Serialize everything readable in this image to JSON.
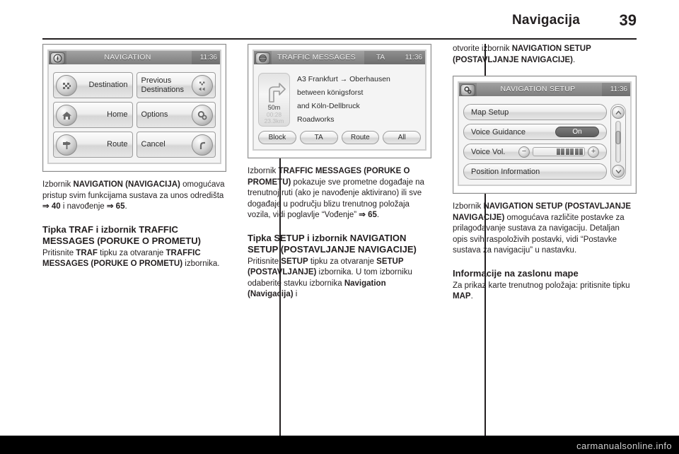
{
  "header": {
    "title": "Navigacija",
    "page_number": "39"
  },
  "screens": {
    "navigation": {
      "title": "NAVIGATION",
      "clock": "11:36",
      "icon": "compass-icon",
      "buttons": [
        {
          "label": "Destination",
          "icon": "checkered-flag-icon"
        },
        {
          "label": "Home",
          "icon": "home-icon"
        },
        {
          "label": "Route",
          "icon": "route-signpost-icon"
        },
        {
          "label": "Previous Destinations",
          "icon": "previous-destinations-icon"
        },
        {
          "label": "Options",
          "icon": "gears-icon"
        },
        {
          "label": "Cancel",
          "icon": "cancel-route-icon"
        }
      ]
    },
    "traffic_messages": {
      "title": "TRAFFIC MESSAGES",
      "ta_label": "TA",
      "clock": "11:36",
      "icon": "traffic-globe-icon",
      "turn": {
        "icon": "turn-right-icon",
        "distance": "50m",
        "eta": "00:28",
        "remaining": "23.3km"
      },
      "message_lines": [
        "A3 Frankfurt → Oberhausen",
        "between königsforst",
        "and Köln-Dellbruck",
        "Roadworks"
      ],
      "buttons": [
        "Block",
        "TA",
        "Route",
        "All"
      ]
    },
    "navigation_setup": {
      "title": "NAVIGATION SETUP",
      "clock": "11:36",
      "icon": "gears-icon",
      "rows": [
        {
          "label": "Map Setup",
          "control": "none"
        },
        {
          "label": "Voice Guidance",
          "control": "toggle",
          "value": "On"
        },
        {
          "label": "Voice Vol.",
          "control": "volume",
          "minus": "−",
          "plus": "+"
        },
        {
          "label": "Position Information",
          "control": "none"
        }
      ],
      "scrollbar": {
        "up": "up-chevron-icon",
        "down": "down-chevron-icon"
      }
    }
  },
  "column1": {
    "para1_pre": "Izbornik ",
    "para1_b1": "NAVIGATION (NAVIGACIJA)",
    "para1_mid": " omogućava pristup svim funkcijama sustava za unos odredišta ",
    "para1_ref1": "⇒ 40",
    "para1_mid2": " i navođenje ",
    "para1_ref2": "⇒ 65",
    "para1_end": ".",
    "heading": "Tipka TRAF i izbornik TRAFFIC MESSAGES (PORUKE O PROMETU)",
    "para2_pre": "Pritisnite ",
    "para2_b1": "TRAF",
    "para2_mid": " tipku za otvaranje ",
    "para2_b2": "TRAFFIC MESSAGES (PORUKE O PROMETU)",
    "para2_end": " izbornika."
  },
  "column2": {
    "para1_pre": "Izbornik ",
    "para1_b1": "TRAFFIC MESSAGES (PORUKE O PROMETU)",
    "para1_mid": " pokazuje sve prometne događaje na trenutnoj ruti (ako je navođenje aktivirano) ili sve događaje u području blizu trenutnog položaja vozila, vidi poglavlje “Vođenje” ",
    "para1_ref": "⇒ 65",
    "para1_end": ".",
    "heading": "Tipka SETUP i izbornik NAVIGATION SETUP (POSTAVLJANJE NAVIGACIJE)",
    "para2_pre": "Pritisnite ",
    "para2_b1": "SETUP",
    "para2_mid": " tipku za otvaranje ",
    "para2_b2": "SETUP (POSTAVLJANJE)",
    "para2_mid2": " izbornika. U tom izborniku odaberite stavku izbornika ",
    "para2_b3": "Navigation (Navigacija)",
    "para2_end": " i"
  },
  "column3": {
    "para0_pre": "otvorite izbornik ",
    "para0_b1": "NAVIGATION SETUP (POSTAVLJANJE NAVIGACIJE)",
    "para0_end": ".",
    "para1_pre": "Izbornik ",
    "para1_b1": "NAVIGATION SETUP (POSTAVLJANJE NAVIGACIJE)",
    "para1_mid": " omogućava različite postavke za prilagođavanje sustava za navigaciju. Detaljan opis svih raspoloživih postavki, vidi “Postavke sustava za navigaciju” u nastavku.",
    "heading": "Informacije na zaslonu mape",
    "para2_pre": "Za prikaz karte trenutnog položaja: pritisnite tipku ",
    "para2_b1": "MAP",
    "para2_end": "."
  },
  "footer": {
    "watermark": "carmanualsonline.info"
  }
}
